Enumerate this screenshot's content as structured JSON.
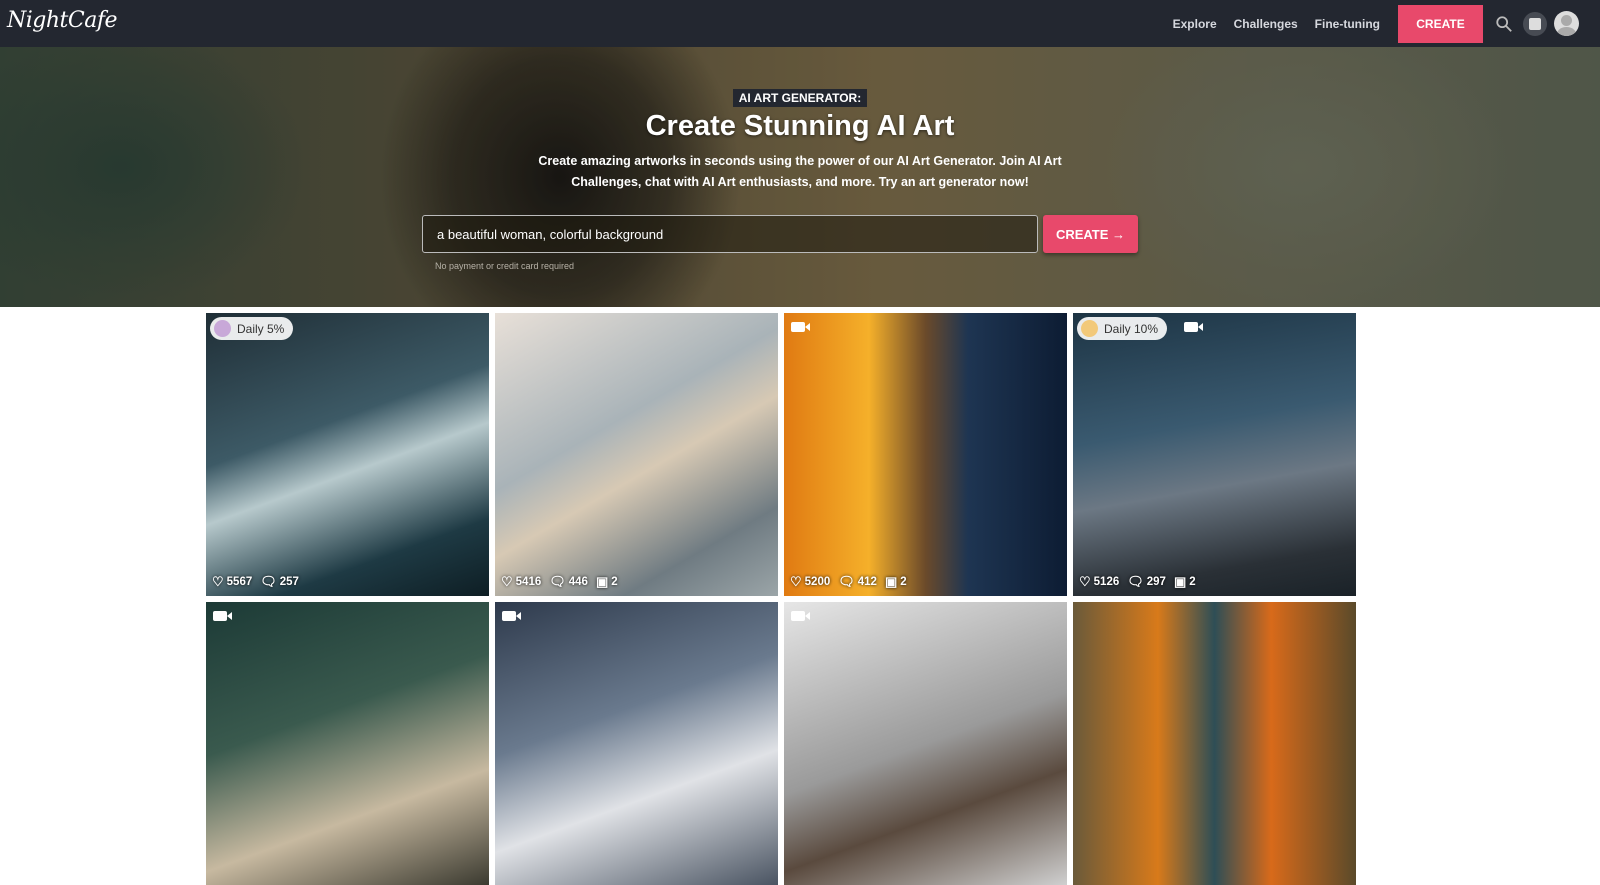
{
  "nav": {
    "logo": "NightCafe",
    "links": [
      "Explore",
      "Challenges",
      "Fine-tuning"
    ],
    "create": "CREATE"
  },
  "hero": {
    "tag": "AI ART GENERATOR:",
    "title": "Create Stunning AI Art",
    "subtitle": "Create amazing artworks in seconds using the power of our AI Art Generator. Join AI Art Challenges, chat with AI Art enthusiasts, and more. Try an art generator now!",
    "prompt_value": "a beautiful woman, colorful background",
    "create_button": "CREATE →",
    "note": "No payment or credit card required"
  },
  "colors": {
    "accent": "#e8496b",
    "nav_bg": "#232730"
  },
  "cards": [
    {
      "badge": "Daily 5%",
      "video": false,
      "likes": "5567",
      "comments": "257",
      "images": "",
      "bg": "linear-gradient(160deg,#1f2e36,#3d5a66 40%,#b7c9cc 55%,#1e3a44 80%,#0e1e24)"
    },
    {
      "badge": "",
      "video": false,
      "likes": "5416",
      "comments": "446",
      "images": "2",
      "bg": "linear-gradient(150deg,#e8e0d8,#a9b3b8 40%,#d7c9b4 55%,#6f7b82 80%,#9ba5a8)"
    },
    {
      "badge": "",
      "video": true,
      "likes": "5200",
      "comments": "412",
      "images": "2",
      "bg": "linear-gradient(90deg,#e07a12,#f5b02a 30%,#6b4a2a 50%,#1e3552 65%,#0d1c33)"
    },
    {
      "badge": "Daily 10%",
      "video": true,
      "likes": "5126",
      "comments": "297",
      "images": "2",
      "bg": "linear-gradient(170deg,#1d3444,#3a5a70 40%,#6c7884 60%,#2a3036 85%,#1a2228)"
    },
    {
      "badge": "",
      "video": true,
      "likes": "",
      "comments": "",
      "images": "",
      "bg": "linear-gradient(160deg,#1c3a36,#3a5a4e 40%,#c7b9a0 70%,#3b3a30)"
    },
    {
      "badge": "",
      "video": true,
      "likes": "",
      "comments": "",
      "images": "",
      "bg": "linear-gradient(160deg,#2e3a4c,#6a7a8e 40%,#e0e2e6 65%,#4a5462)"
    },
    {
      "badge": "",
      "video": true,
      "likes": "",
      "comments": "",
      "images": "",
      "bg": "linear-gradient(160deg,#e6e6e6,#9a9a9a 50%,#5a4a3e 70%,#cfcfcf)"
    },
    {
      "badge": "",
      "video": false,
      "likes": "",
      "comments": "",
      "images": "",
      "bg": "linear-gradient(90deg,#6a5a3a,#d87a1a 30%,#2e4e56 50%,#d86a1a 70%,#5a4a2a)"
    }
  ]
}
